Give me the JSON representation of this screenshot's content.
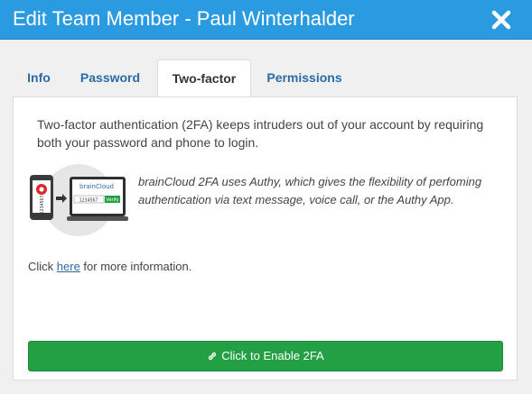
{
  "header": {
    "title": "Edit Team Member - Paul Winterhalder",
    "close_icon": "close-icon"
  },
  "tabs": [
    {
      "label": "Info",
      "active": false
    },
    {
      "label": "Password",
      "active": false
    },
    {
      "label": "Two-factor",
      "active": true
    },
    {
      "label": "Permissions",
      "active": false
    }
  ],
  "panel": {
    "intro": "Two-factor authentication (2FA) keeps intruders out of your account by requiring both your password and phone to login.",
    "description": "brainCloud 2FA uses Authy, which gives the flexibility of perfoming authentication via text message, voice call, or the Authy App.",
    "illustration": {
      "phone_code": "1234567",
      "laptop_brand": "brainCloud",
      "laptop_code": "1234567",
      "verify_label": "Verify"
    },
    "more_prefix": "Click ",
    "more_link": "here",
    "more_suffix": " for more information.",
    "enable_button": "Click to Enable 2FA",
    "enable_icon": "link-icon"
  },
  "colors": {
    "header_bg": "#2a9be0",
    "tab_link": "#2a6aa6",
    "button_green": "#23a043"
  }
}
